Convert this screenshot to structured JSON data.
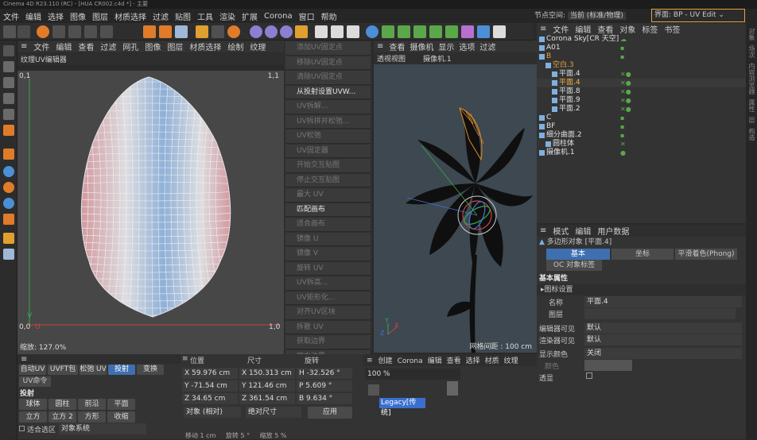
{
  "window": {
    "title": "Cinema 4D R23.110 (RC) - [HUA CR002.c4d *] - 主要"
  },
  "menu": [
    "文件",
    "编辑",
    "选择",
    "图像",
    "图层",
    "材质选择",
    "过滤",
    "贴图",
    "工具",
    "渲染",
    "扩展",
    "Corona",
    "窗口",
    "帮助"
  ],
  "nodespace": {
    "label": "节点空间:",
    "value": "当前 (标准/物理)"
  },
  "interface": {
    "label": "界面:",
    "value": "BP - UV Edit"
  },
  "uv_editor": {
    "menu": [
      "文件",
      "编辑",
      "查看",
      "过滤",
      "网孔",
      "图像",
      "图层",
      "材质选择",
      "绘制",
      "纹理"
    ],
    "tab": "纹理UV编辑器",
    "coord_tl": "0,1",
    "coord_tr": "1,1",
    "coord_bl": "0,0",
    "coord_br": "1,0",
    "v_label": "V",
    "u_label": "U",
    "zoom": "缩放: 127.0%"
  },
  "uv_tools": [
    "添加UV固定点",
    "移除UV固定点",
    "清除UV固定点",
    "从投射设置UVW...",
    "UV拆解...",
    "UV拆拼并松弛...",
    "UV松弛",
    "UV固定器",
    "开始交互贴图",
    "停止交互贴图",
    "最大 UV",
    "匹配画布",
    "适合画布",
    "镜像 U",
    "镜像 V",
    "旋转 UV",
    "UV拆高...",
    "UV矩形化...",
    "对齐UV区块",
    "拆散 UV",
    "获取边界",
    "四方边界",
    "拷贝 UV",
    "粘贴 UV",
    "重置UV"
  ],
  "uv_tools_active": [
    3,
    11
  ],
  "viewport": {
    "menu": [
      "查看",
      "摄像机",
      "显示",
      "选项",
      "过滤"
    ],
    "title": "透视视图",
    "camera": "摄像机.1",
    "grid": "网格间距 : 100 cm",
    "axis_x": "X",
    "axis_y": "Y",
    "axis_z": "Z"
  },
  "object_manager": {
    "menu": [
      "文件",
      "编辑",
      "查看",
      "对象",
      "标签",
      "书签"
    ],
    "objects": [
      {
        "name": "Corona Sky[CR 天空]",
        "indent": 0,
        "color": "#e0e0e0",
        "tags": "☁"
      },
      {
        "name": "A01",
        "indent": 0,
        "color": "#e0e0e0",
        "tags": "▪"
      },
      {
        "name": "B",
        "indent": 0,
        "color": "#e8a33a",
        "tags": "▪"
      },
      {
        "name": "空白.3",
        "indent": 1,
        "color": "#e8a33a",
        "tags": ""
      },
      {
        "name": "平面.4",
        "indent": 2,
        "color": "#e0e0e0",
        "tags": "✕●"
      },
      {
        "name": "平面.4",
        "indent": 2,
        "color": "#f0b040",
        "tags": "✕●"
      },
      {
        "name": "平面.8",
        "indent": 2,
        "color": "#e0e0e0",
        "tags": "✕●"
      },
      {
        "name": "平面.9",
        "indent": 2,
        "color": "#e0e0e0",
        "tags": "✕●"
      },
      {
        "name": "平面.2",
        "indent": 2,
        "color": "#e0e0e0",
        "tags": "✕●"
      },
      {
        "name": "C",
        "indent": 0,
        "color": "#e0e0e0",
        "tags": "▪"
      },
      {
        "name": "BF",
        "indent": 0,
        "color": "#e0e0e0",
        "tags": "▪"
      },
      {
        "name": "细分曲面.2",
        "indent": 0,
        "color": "#e0e0e0",
        "tags": "▪"
      },
      {
        "name": "圆柱体",
        "indent": 1,
        "color": "#e0e0e0",
        "tags": "✕"
      },
      {
        "name": "摄像机.1",
        "indent": 0,
        "color": "#e0e0e0",
        "tags": "●"
      }
    ]
  },
  "attributes": {
    "menu": [
      "模式",
      "编辑",
      "用户数据"
    ],
    "object": "多边形对象 [平面.4]",
    "tabs": [
      "基本",
      "坐标",
      "平滑着色(Phong)"
    ],
    "tab2": "OC 对象标签",
    "section": "基本属性",
    "subsection": "▸图标设置",
    "name_label": "名称",
    "name_value": "平面.4",
    "layer_label": "图层",
    "editor_vis_label": "编辑器可见",
    "editor_vis_value": "默认",
    "render_vis_label": "渲染器可见",
    "render_vis_value": "默认",
    "display_color_label": "显示颜色",
    "display_color_value": "关闭",
    "color_label": "颜色",
    "transparent_label": "透显"
  },
  "coords": {
    "headers": [
      "位置",
      "尺寸",
      "旋转"
    ],
    "x": "59.976 cm",
    "y": "-71.54 cm",
    "z": "34.65 cm",
    "sx": "150.313 cm",
    "sy": "121.46 cm",
    "sz": "361.54 cm",
    "h": "-32.526 °",
    "p": "5.609 °",
    "b": "9.634 °",
    "mode": "对象 (相对)",
    "size_mode": "绝对尺寸",
    "apply": "应用"
  },
  "uv_commands": {
    "tabs": [
      "自动UV",
      "UVFT包",
      "松弛 UV",
      "投射",
      "变换"
    ],
    "tab2": "UV命令",
    "section": "投射",
    "row1": [
      "球体",
      "圆柱",
      "前沿",
      "平面"
    ],
    "row2": [
      "立方",
      "立方 2",
      "方形",
      "收缩"
    ],
    "fit": "适合选区",
    "system": "对象系统"
  },
  "material": {
    "menu": [
      "创建",
      "Corona",
      "编辑",
      "查看",
      "选择",
      "材质",
      "纹理"
    ],
    "zoom": "100 %",
    "legacy": "Legacy[传统]"
  },
  "bottombar": {
    "move": "移动 1 cm",
    "rotate": "旋转 5 °",
    "scale": "缩放 5 %"
  },
  "right_tabs": [
    "对象",
    "场次",
    "内容浏览器",
    "属性",
    "层",
    "构造"
  ]
}
